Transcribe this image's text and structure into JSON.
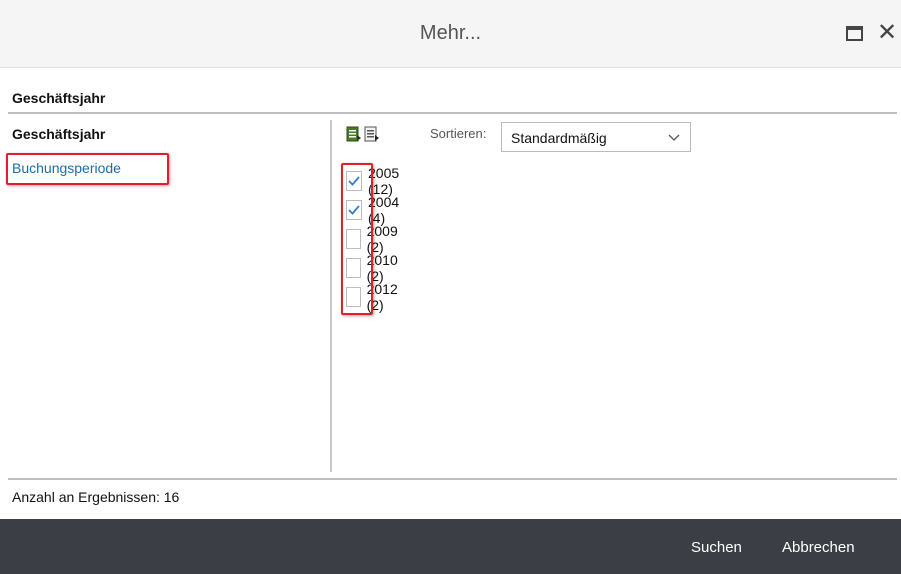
{
  "window": {
    "title": "Mehr...",
    "maximize_label": "",
    "close_glyph": "✕"
  },
  "section": {
    "heading": "Geschäftsjahr"
  },
  "left_panel": {
    "items": [
      {
        "label": "Geschäftsjahr",
        "active": true
      },
      {
        "label": "Buchungsperiode",
        "active": false
      }
    ]
  },
  "toolbar": {
    "icons": [
      "select-all-icon",
      "deselect-all-icon"
    ],
    "sort_label": "Sortieren:",
    "sort_value": "Standardmäßig"
  },
  "values": [
    {
      "label": "2005 (12)",
      "checked": true
    },
    {
      "label": "2004 (4)",
      "checked": true
    },
    {
      "label": "2009 (2)",
      "checked": false
    },
    {
      "label": "2010 (2)",
      "checked": false
    },
    {
      "label": "2012 (2)",
      "checked": false
    }
  ],
  "status": {
    "result_count": "Anzahl an Ergebnissen: 16"
  },
  "footer": {
    "search_label": "Suchen",
    "cancel_label": "Abbrechen"
  },
  "colors": {
    "accent": "#1a6ea8",
    "highlight": "#e01f26",
    "footer_bg": "#3b3f45"
  }
}
